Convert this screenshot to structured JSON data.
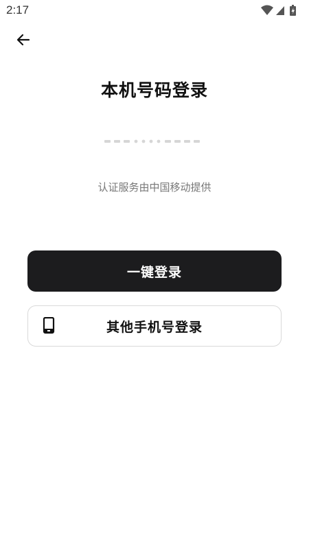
{
  "status_bar": {
    "time": "2:17",
    "icons": [
      "wifi-icon",
      "cell-signal-icon",
      "battery-charging-icon"
    ]
  },
  "header": {
    "back_icon": "arrow-left-icon"
  },
  "main": {
    "title": "本机号码登录",
    "provider_note": "认证服务由中国移动提供",
    "primary_button_label": "一键登录",
    "secondary_button_label": "其他手机号登录",
    "secondary_button_icon": "phone-icon"
  },
  "colors": {
    "primary_button_bg": "#1c1c1e",
    "primary_button_text": "#ffffff",
    "masked_number_placeholder": "#d6d6d6",
    "note_text": "#777777"
  }
}
